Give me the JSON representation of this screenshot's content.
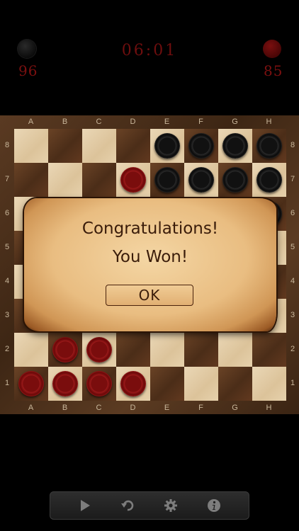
{
  "hud": {
    "black_score": "96",
    "red_score": "85",
    "timer": "06:01"
  },
  "board": {
    "columns": [
      "A",
      "B",
      "C",
      "D",
      "E",
      "F",
      "G",
      "H"
    ],
    "rows": [
      "8",
      "7",
      "6",
      "5",
      "4",
      "3",
      "2",
      "1"
    ],
    "pieces": [
      {
        "square": "E8",
        "color": "black"
      },
      {
        "square": "F8",
        "color": "black"
      },
      {
        "square": "G8",
        "color": "black"
      },
      {
        "square": "H8",
        "color": "black"
      },
      {
        "square": "D7",
        "color": "red"
      },
      {
        "square": "E7",
        "color": "black"
      },
      {
        "square": "F7",
        "color": "black"
      },
      {
        "square": "G7",
        "color": "black"
      },
      {
        "square": "H7",
        "color": "black"
      },
      {
        "square": "H6",
        "color": "black"
      },
      {
        "square": "B2",
        "color": "red"
      },
      {
        "square": "C2",
        "color": "red"
      },
      {
        "square": "A1",
        "color": "red"
      },
      {
        "square": "B1",
        "color": "red"
      },
      {
        "square": "C1",
        "color": "red"
      },
      {
        "square": "D1",
        "color": "red"
      }
    ]
  },
  "dialog": {
    "line1": "Congratulations!",
    "line2": "You Won!",
    "ok_label": "OK"
  },
  "toolbar": {
    "buttons": [
      "play-icon",
      "undo-icon",
      "gear-icon",
      "info-icon"
    ]
  },
  "colors": {
    "score_red": "#7c1010",
    "background": "#000000"
  }
}
